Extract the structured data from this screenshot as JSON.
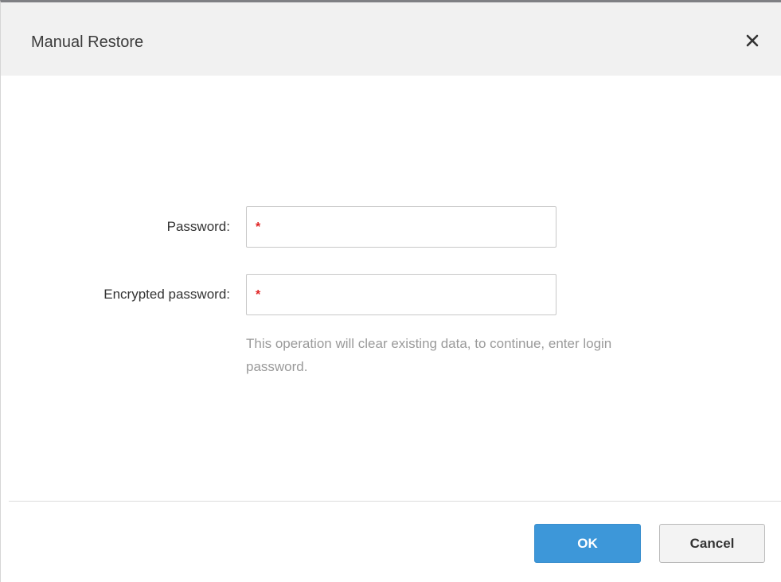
{
  "dialog": {
    "title": "Manual Restore",
    "close_icon": "close-icon"
  },
  "form": {
    "password_label": "Password:",
    "password_required": "*",
    "password_value": "",
    "encrypted_label": "Encrypted password:",
    "encrypted_required": "*",
    "encrypted_value": "",
    "hint_line1": "This operation will clear existing data, to continue, enter login",
    "hint_line2": "password."
  },
  "footer": {
    "ok_label": "OK",
    "cancel_label": "Cancel"
  },
  "colors": {
    "primary": "#3d97d9",
    "required": "#e02424",
    "header_bg": "#f1f1f1"
  }
}
